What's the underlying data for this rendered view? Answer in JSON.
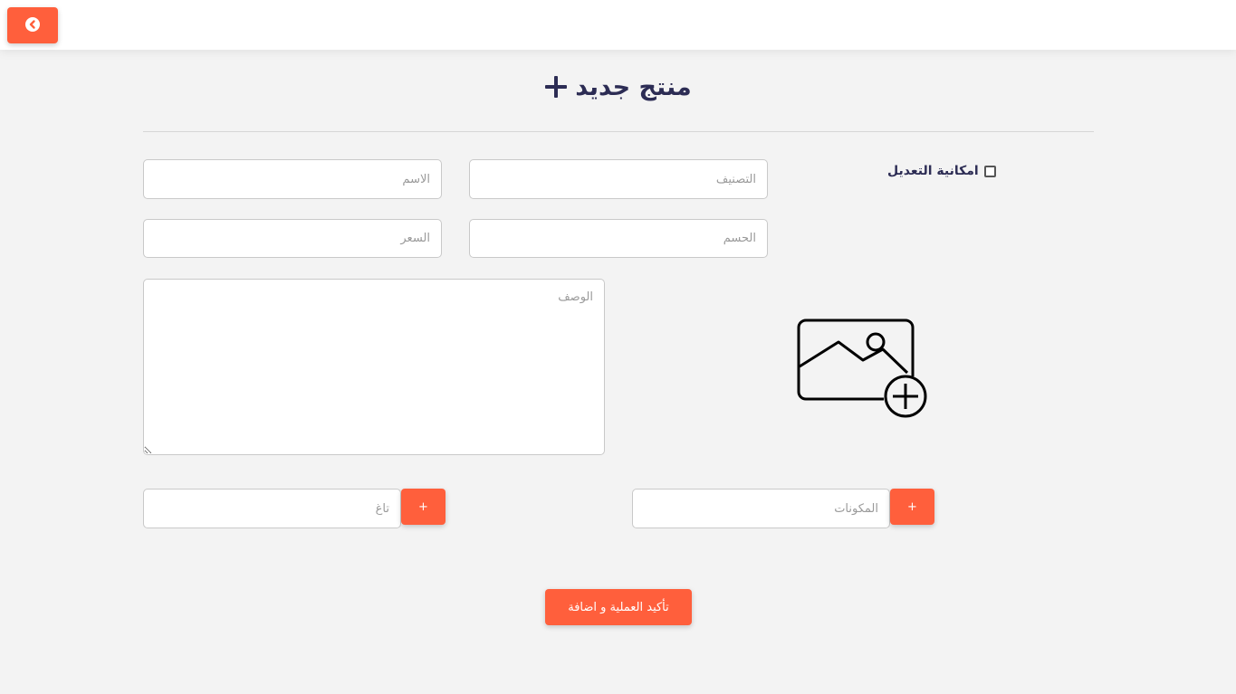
{
  "header": {
    "back_icon": "arrow-left-circle-icon"
  },
  "page": {
    "title": "منتج جديد",
    "title_icon": "plus-icon"
  },
  "form": {
    "name_placeholder": "الاسم",
    "category_placeholder": "التصنيف",
    "price_placeholder": "السعر",
    "size_placeholder": "الحسم",
    "description_placeholder": "الوصف",
    "editable_label": "امكانية التعديل",
    "image_icon": "image-add-icon",
    "tag_placeholder": "تاغ",
    "ingredients_placeholder": "المكونات",
    "add_label": "+",
    "submit_label": "تأكيد العملية و اضافة"
  },
  "colors": {
    "accent": "#ff5f3c",
    "title": "#2c2c54",
    "background": "#f3f3f3"
  }
}
